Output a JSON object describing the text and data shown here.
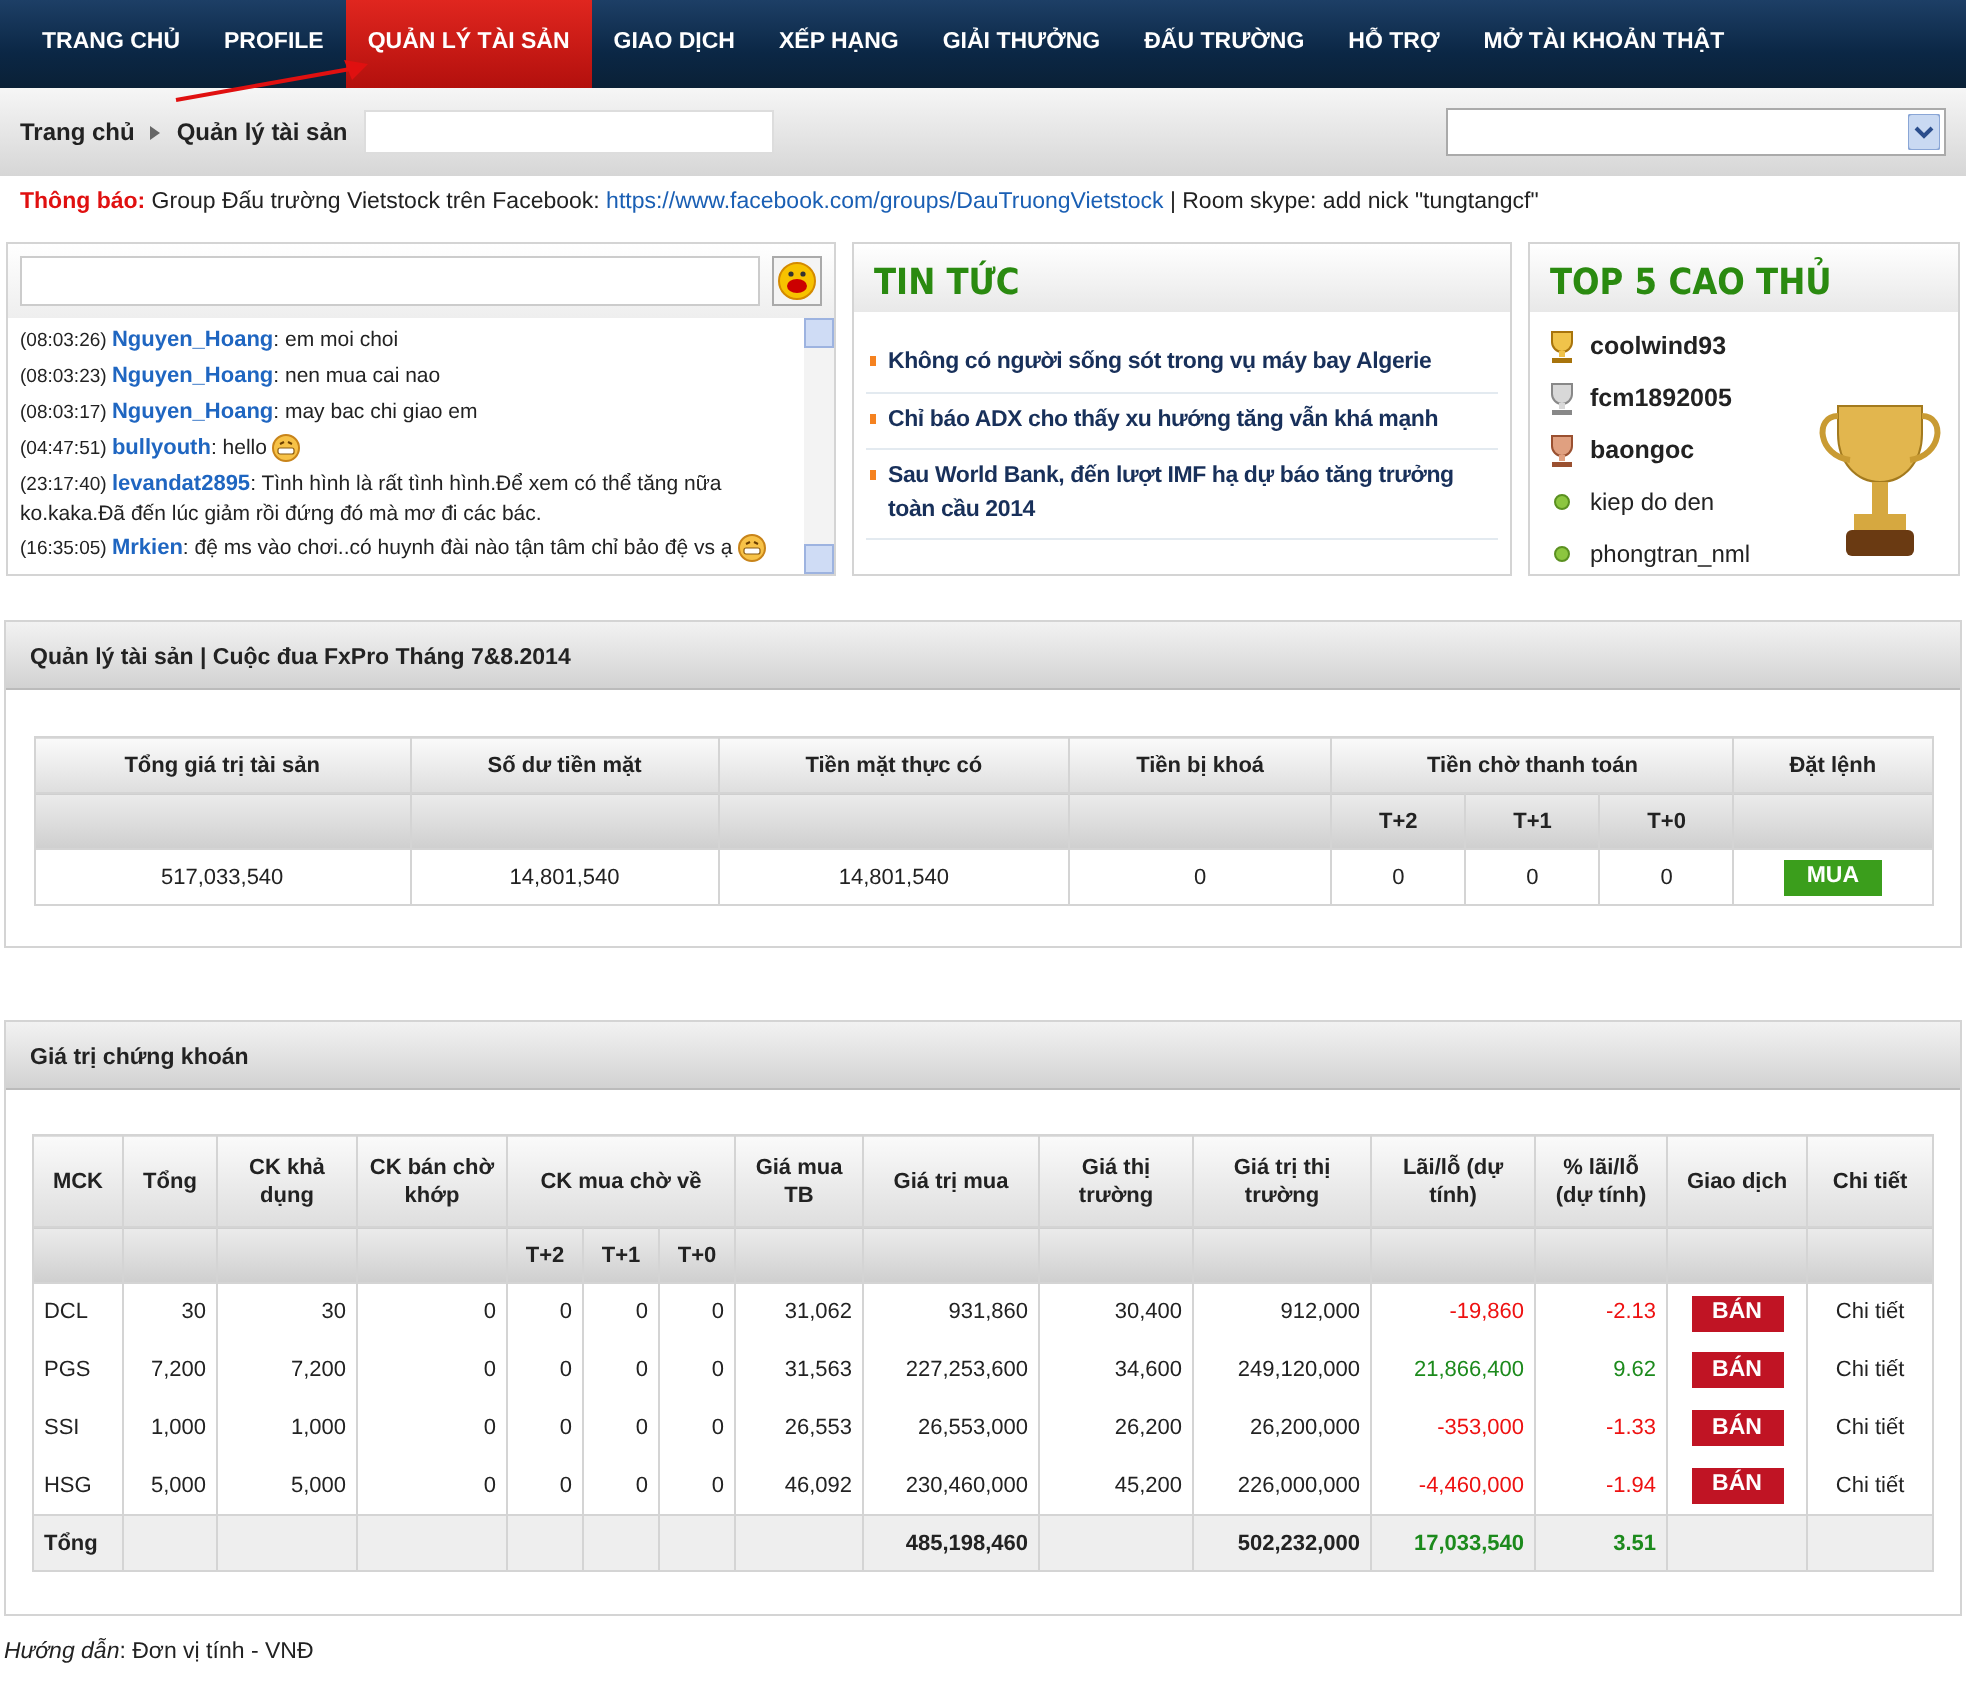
{
  "nav": [
    {
      "label": "TRANG CHỦ",
      "selected": false
    },
    {
      "label": "PROFILE",
      "selected": false
    },
    {
      "label": "QUẢN LÝ TÀI SẢN",
      "selected": true
    },
    {
      "label": "GIAO DỊCH",
      "selected": false
    },
    {
      "label": "XẾP HẠNG",
      "selected": false
    },
    {
      "label": "GIẢI THƯỞNG",
      "selected": false
    },
    {
      "label": "ĐẤU TRƯỜNG",
      "selected": false
    },
    {
      "label": "HỖ TRỢ",
      "selected": false
    },
    {
      "label": "MỞ TÀI KHOẢN THẬT",
      "selected": false
    }
  ],
  "breadcrumb": [
    "Trang chủ",
    "Quản lý tài sản"
  ],
  "notice": {
    "label": "Thông báo:",
    "text": "Group Đấu trường Vietstock trên Facebook:",
    "link": "https://www.facebook.com/groups/DauTruongVietstock",
    "after": "| Room skype: add nick \"tungtangcf\""
  },
  "chat": [
    {
      "time": "(08:03:26)",
      "user": "Nguyen_Hoang",
      "text": ": em moi choi",
      "emoticon": false
    },
    {
      "time": "(08:03:23)",
      "user": "Nguyen_Hoang",
      "text": ": nen mua cai nao",
      "emoticon": false
    },
    {
      "time": "(08:03:17)",
      "user": "Nguyen_Hoang",
      "text": ": may bac chi giao em",
      "emoticon": false
    },
    {
      "time": "(04:47:51)",
      "user": "bullyouth",
      "text": ": hello",
      "emoticon": true
    },
    {
      "time": "(23:17:40)",
      "user": "levandat2895",
      "text": ": Tình hình là rất tình hình.Để xem có thể tăng nữa ko.kaka.Đã đến lúc giảm rồi đứng đó mà mơ đi các bác.",
      "emoticon": false
    },
    {
      "time": "(16:35:05)",
      "user": "Mrkien",
      "text": ": đệ ms vào chơi..có huynh đài nào tận tâm chỉ bảo đệ vs ạ",
      "emoticon": true
    }
  ],
  "news": {
    "title": "TIN TỨC",
    "items": [
      "Không có người sống sót trong vụ máy bay Algerie",
      "Chỉ báo ADX cho thấy xu hướng tăng vẫn khá mạnh",
      "Sau World Bank, đến lượt IMF hạ dự báo tăng trưởng toàn cầu 2014"
    ]
  },
  "top": {
    "title": "TOP 5 CAO THỦ",
    "players": [
      {
        "name": "coolwind93",
        "kind": "gold"
      },
      {
        "name": "fcm1892005",
        "kind": "silver"
      },
      {
        "name": "baongoc",
        "kind": "bronze"
      },
      {
        "name": "kiep do den",
        "kind": "member"
      },
      {
        "name": "phongtran_nml",
        "kind": "member"
      }
    ]
  },
  "assets": {
    "title": "Quản lý tài sản | Cuộc đua FxPro Tháng 7&8.2014",
    "columns": [
      {
        "label": "Tổng giá trị tài sản"
      },
      {
        "label": "Số dư tiền mặt"
      },
      {
        "label": "Tiền mặt thực có"
      },
      {
        "label": "Tiền bị khoá"
      },
      {
        "label": "Tiền chờ thanh toán",
        "subcolumns": [
          "T+2",
          "T+1",
          "T+0"
        ]
      },
      {
        "label": "Đặt lệnh"
      }
    ],
    "row": [
      "517,033,540",
      "14,801,540",
      "14,801,540",
      "0",
      [
        "0",
        "0",
        "0"
      ]
    ],
    "action": "MUA"
  },
  "securities": {
    "title": "Giá trị chứng khoán",
    "columns": [
      {
        "label": "MCK"
      },
      {
        "label": "Tổng"
      },
      {
        "label": "CK khả dụng"
      },
      {
        "label": "CK bán chờ khớp"
      },
      {
        "label": "CK mua chờ về",
        "subcolumns": [
          "T+2",
          "T+1",
          "T+0"
        ]
      },
      {
        "label": "Giá mua TB"
      },
      {
        "label": "Giá trị mua"
      },
      {
        "label": "Giá thị trường"
      },
      {
        "label": "Giá trị thị trường"
      },
      {
        "label": "Lãi/lỗ (dự tính)"
      },
      {
        "label": "% lãi/lỗ (dự tính)"
      },
      {
        "label": "Giao dịch"
      },
      {
        "label": "Chi tiết"
      }
    ],
    "rows": [
      {
        "cells": [
          "DCL",
          "30",
          "30",
          "0",
          [
            "0",
            "0",
            "0"
          ],
          "31,062",
          "931,860",
          "30,400",
          "912,000",
          "-19,860",
          "-2.13"
        ],
        "profit": false,
        "action": "BÁN",
        "detail": "Chi tiết"
      },
      {
        "cells": [
          "PGS",
          "7,200",
          "7,200",
          "0",
          [
            "0",
            "0",
            "0"
          ],
          "31,563",
          "227,253,600",
          "34,600",
          "249,120,000",
          "21,866,400",
          "9.62"
        ],
        "profit": true,
        "action": "BÁN",
        "detail": "Chi tiết"
      },
      {
        "cells": [
          "SSI",
          "1,000",
          "1,000",
          "0",
          [
            "0",
            "0",
            "0"
          ],
          "26,553",
          "26,553,000",
          "26,200",
          "26,200,000",
          "-353,000",
          "-1.33"
        ],
        "profit": false,
        "action": "BÁN",
        "detail": "Chi tiết"
      },
      {
        "cells": [
          "HSG",
          "5,000",
          "5,000",
          "0",
          [
            "0",
            "0",
            "0"
          ],
          "46,092",
          "230,460,000",
          "45,200",
          "226,000,000",
          "-4,460,000",
          "-1.94"
        ],
        "profit": false,
        "action": "BÁN",
        "detail": "Chi tiết"
      }
    ],
    "total": {
      "label": "Tổng",
      "buy_value": "485,198,460",
      "market_value": "502,232,000",
      "gain": "17,033,540",
      "gain_pct": "3.51",
      "profit": true
    }
  },
  "footer": {
    "label": "Hướng dẫn",
    "text": ": Đơn vị tính - VNĐ"
  }
}
